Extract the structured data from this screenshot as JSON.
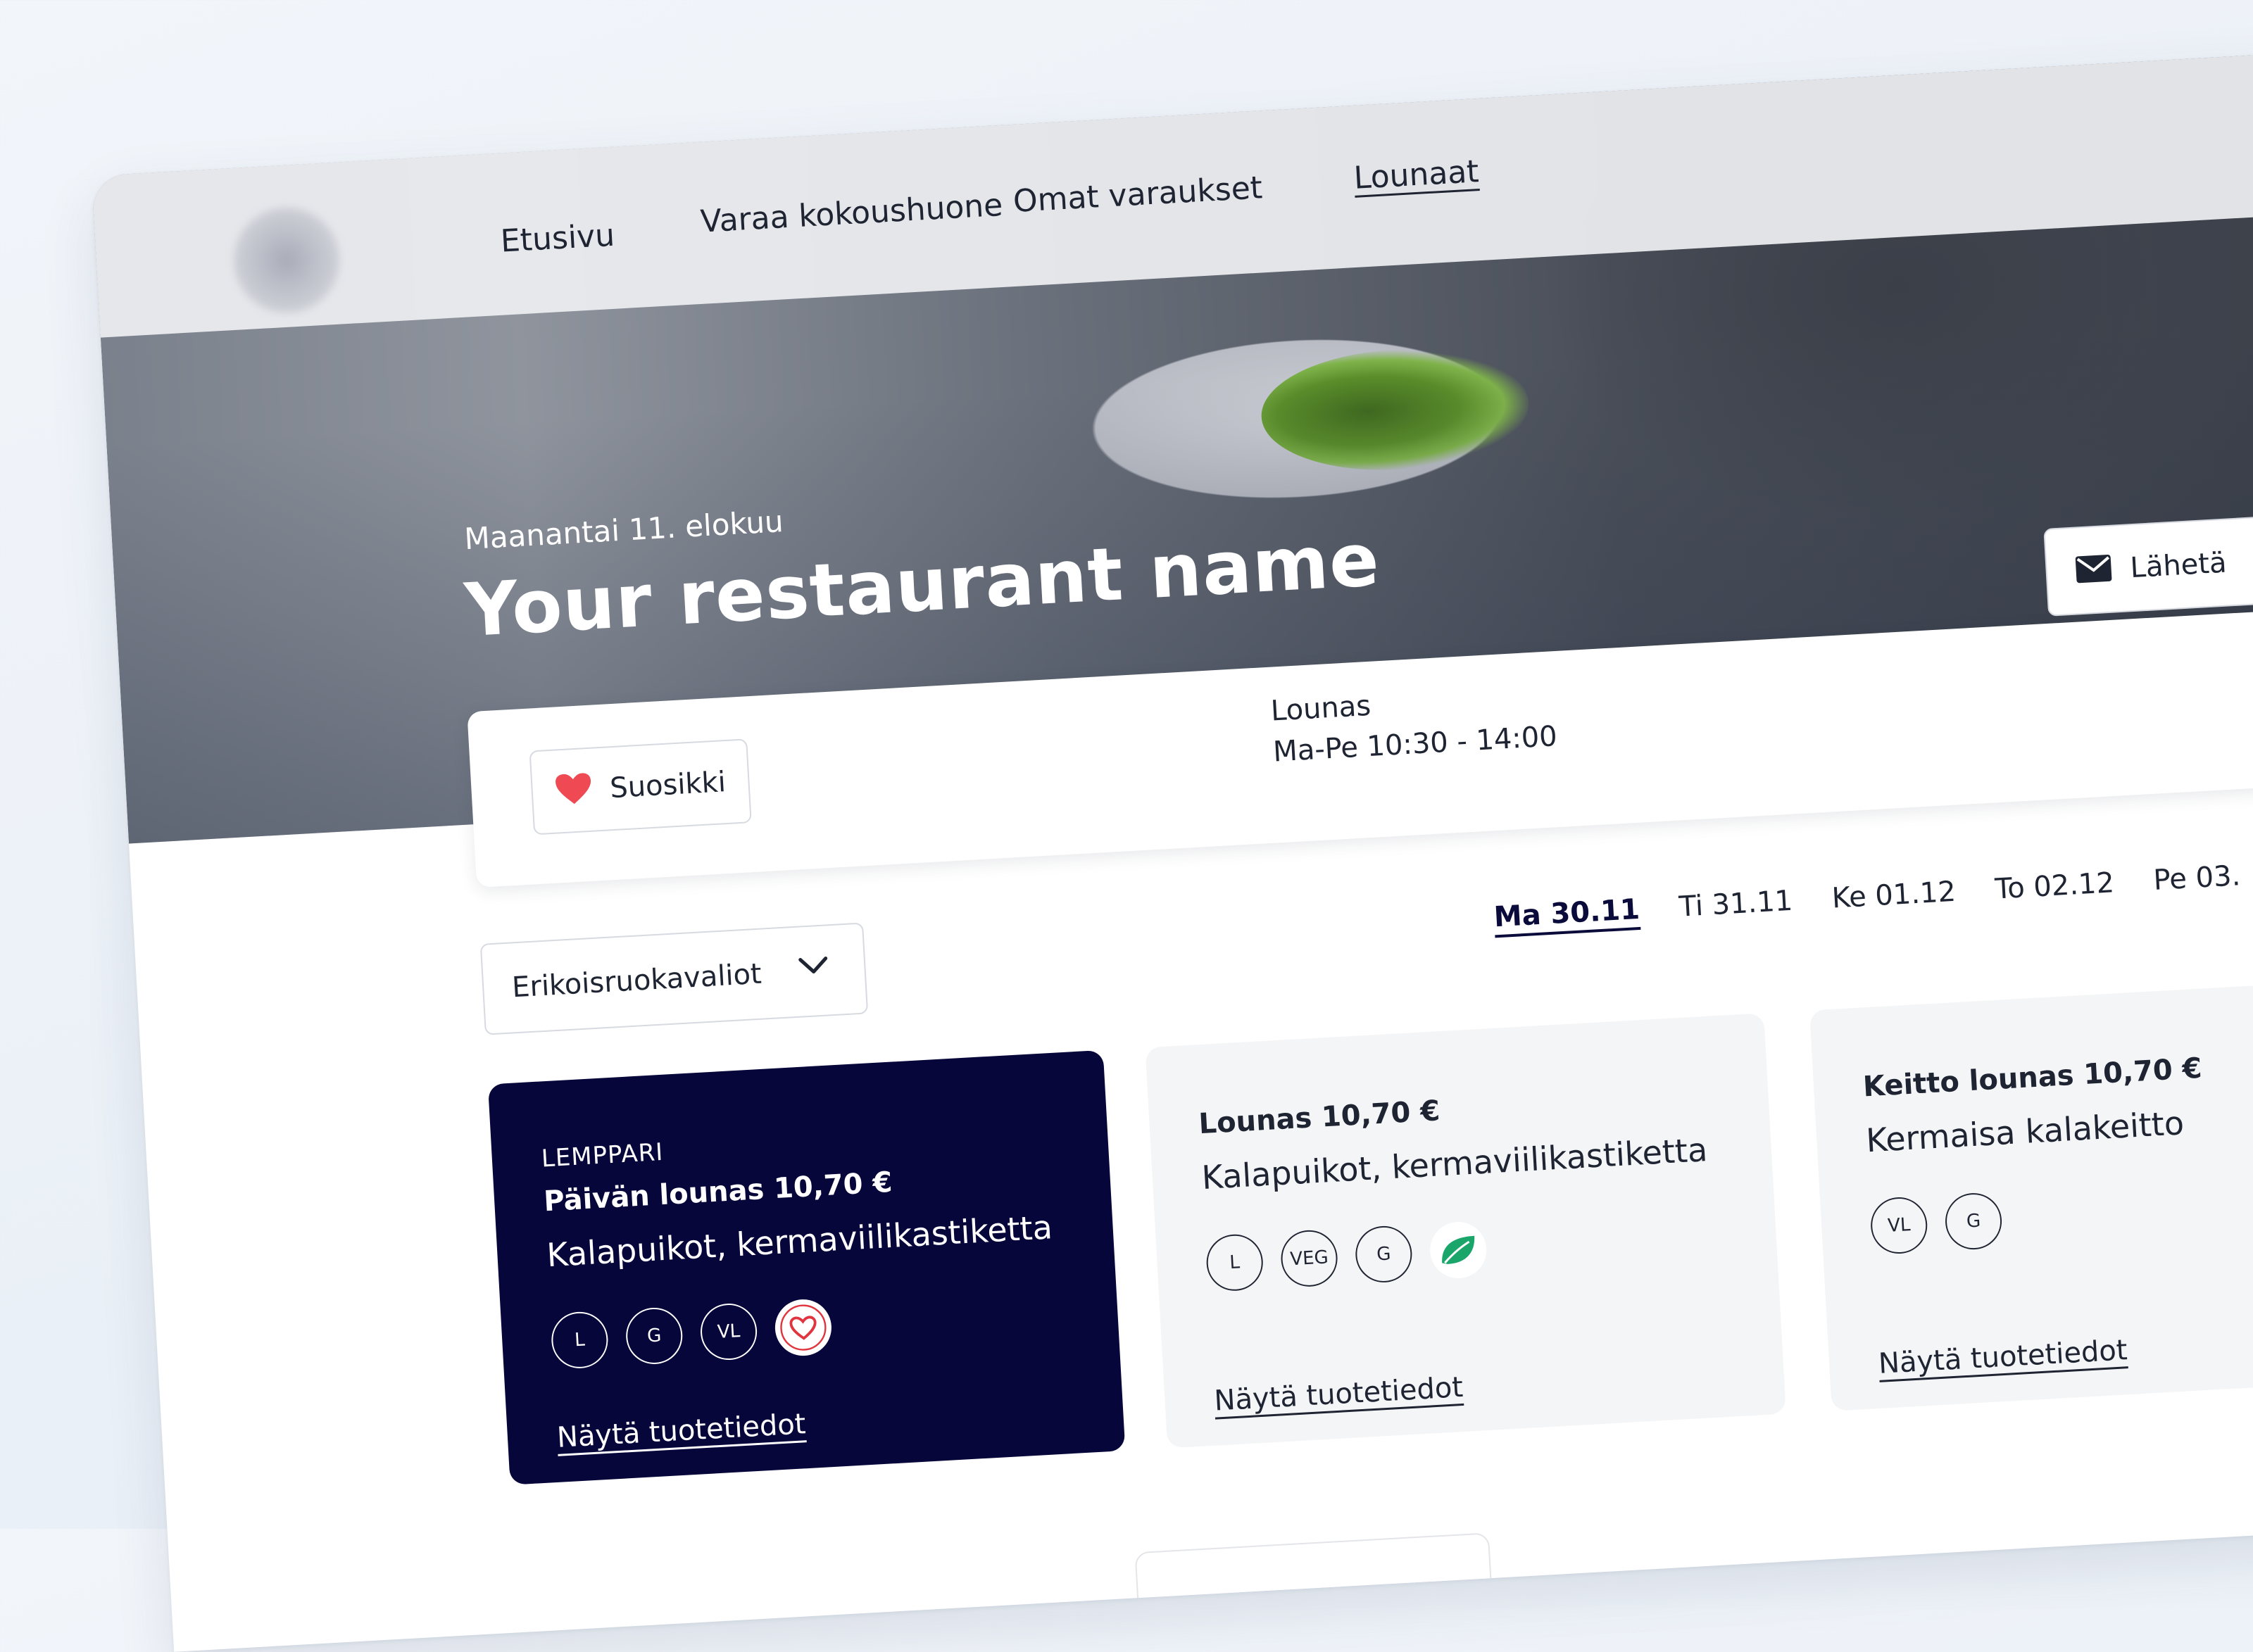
{
  "nav": {
    "items": [
      {
        "label": "Etusivu",
        "active": false
      },
      {
        "label": "Varaa kokoushuone",
        "active": false
      },
      {
        "label": "Omat varaukset",
        "active": false
      },
      {
        "label": "Lounaat",
        "active": true
      }
    ]
  },
  "hero": {
    "date": "Maanantai 11. elokuu",
    "title": "Your restaurant name",
    "send_label": "Lähetä",
    "send_icon": "mail-icon"
  },
  "info": {
    "favorite_label": "Suosikki",
    "favorite_icon": "heart-icon",
    "hours_title": "Lounas",
    "hours_value": "Ma-Pe 10:30 - 14:00"
  },
  "filter": {
    "diet_label": "Erikoisruokavaliot",
    "diet_icon": "chevron-down-icon"
  },
  "days": [
    {
      "label": "Ma  30.11",
      "active": true
    },
    {
      "label": "Ti  31.11",
      "active": false
    },
    {
      "label": "Ke  01.12",
      "active": false
    },
    {
      "label": "To  02.12",
      "active": false
    },
    {
      "label": "Pe  03.",
      "active": false
    }
  ],
  "menu": [
    {
      "badge": "LEMPPARI",
      "title": "Päivän lounas 10,70 €",
      "desc": "Kalapuikot, kermaviilikastiketta",
      "tags": [
        "L",
        "G",
        "VL"
      ],
      "extra_icon": "heart-seal-icon",
      "link": "Näytä tuotetiedot",
      "style": "dark"
    },
    {
      "badge": "",
      "title": "Lounas 10,70 €",
      "desc": "Kalapuikot, kermaviilikastiketta",
      "tags": [
        "L",
        "VEG",
        "G"
      ],
      "extra_icon": "leaf-icon",
      "link": "Näytä tuotetiedot",
      "style": "light"
    },
    {
      "badge": "",
      "title": "Keitto lounas 10,70 €",
      "desc": "Kermaisa kalakeitto",
      "tags": [
        "VL",
        "G"
      ],
      "extra_icon": "",
      "link": "Näytä tuotetiedot",
      "style": "light"
    }
  ],
  "colors": {
    "brand_dark": "#06063a",
    "heart": "#ef4a54",
    "leaf": "#1aa66a"
  }
}
